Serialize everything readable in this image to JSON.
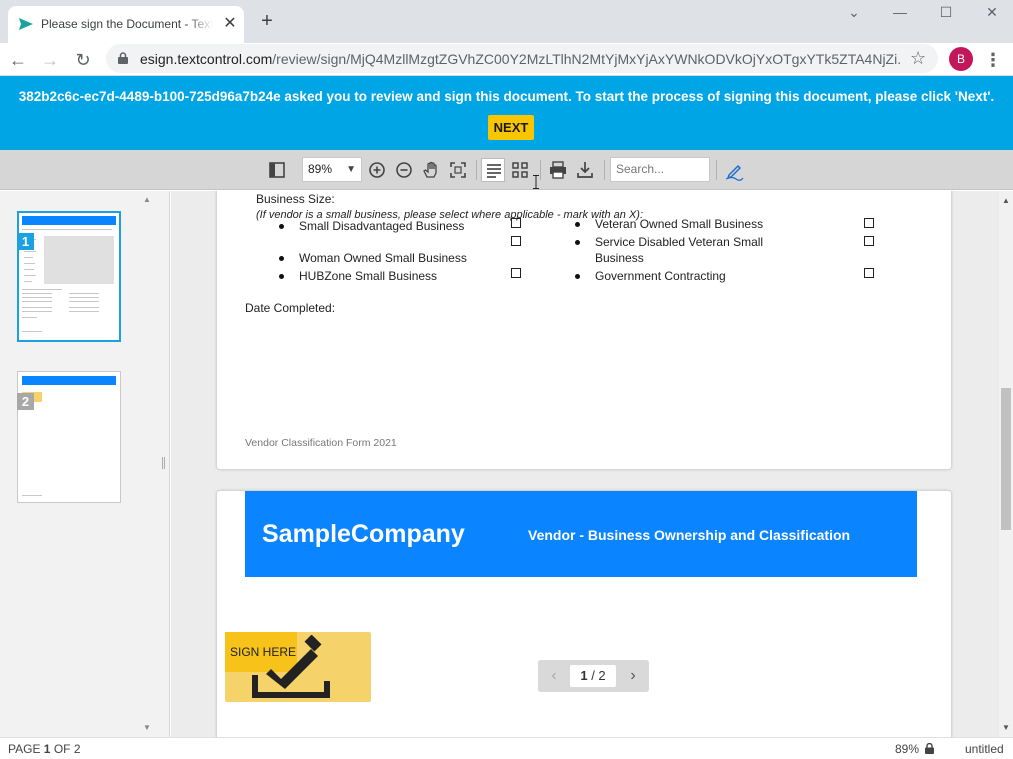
{
  "browser": {
    "tab_title": "Please sign the Document - TextControl",
    "url_domain": "esign.textcontrol.com",
    "url_path": "/review/sign/MjQ4MzllMzgtZGVhZC00Y2MzLTlhN2MtYjMxYjAxYWNkODVkOjYxOTgxYTk5ZTA4NjZi...",
    "avatar_letter": "B"
  },
  "banner": {
    "message": "382b2c6c-ec7d-4489-b100-725d96a7b24e asked you to review and sign this document. To start the process of signing this document, please click 'Next'.",
    "next_label": "NEXT",
    "bg_color": "#00a5e6",
    "button_color": "#f7c600"
  },
  "toolbar": {
    "zoom_value": "89%",
    "search_placeholder": "Search..."
  },
  "thumbnails": [
    {
      "number": "1",
      "selected": true
    },
    {
      "number": "2",
      "selected": false
    }
  ],
  "page1": {
    "business_size_label": "Business Size:",
    "instruction": "(If vendor is a small business, please select where applicable - mark with an X):",
    "left_options": [
      "Small Disadvantaged Business",
      "Woman Owned Small Business",
      "HUBZone Small Business"
    ],
    "right_options": [
      "Veteran Owned Small Business",
      "Service Disabled Veteran Small",
      "Business",
      "Government Contracting"
    ],
    "date_completed_label": "Date Completed:",
    "footer": "Vendor Classification Form 2021"
  },
  "page2": {
    "company": "SampleCompany",
    "subtitle": "Vendor - Business Ownership and Classification",
    "header_color": "#0a84ff"
  },
  "sign_here": {
    "label": "SIGN HERE"
  },
  "pager": {
    "display": "1 / 2",
    "current": "1",
    "separator": "/ 2"
  },
  "status": {
    "page_prefix": "PAGE ",
    "page_current": "1",
    "page_suffix": " OF 2",
    "zoom": "89%",
    "doc_name": "untitled"
  }
}
